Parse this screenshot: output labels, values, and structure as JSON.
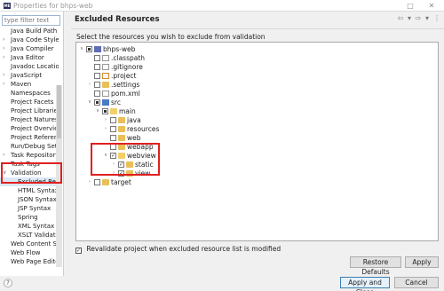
{
  "window": {
    "app_icon": "ME",
    "title": "Properties for bhps-web",
    "controls": [
      "□",
      "✕"
    ]
  },
  "left": {
    "filter_placeholder": "type filter text",
    "items": [
      {
        "label": "Java Build Path"
      },
      {
        "label": "Java Code Style",
        "caret": "›"
      },
      {
        "label": "Java Compiler",
        "caret": "›"
      },
      {
        "label": "Java Editor",
        "caret": "›"
      },
      {
        "label": "Javadoc Location"
      },
      {
        "label": "JavaScript",
        "caret": "›"
      },
      {
        "label": "Maven",
        "caret": "›"
      },
      {
        "label": "Namespaces"
      },
      {
        "label": "Project Facets"
      },
      {
        "label": "Project Libraries"
      },
      {
        "label": "Project Natures"
      },
      {
        "label": "Project Overview"
      },
      {
        "label": "Project References"
      },
      {
        "label": "Run/Debug Settings"
      },
      {
        "label": "Task Repository",
        "caret": "›"
      },
      {
        "label": "Task Tags"
      },
      {
        "label": "Validation",
        "caret": "∨"
      },
      {
        "label": "Excluded Resources",
        "child": true,
        "selected": true
      },
      {
        "label": "HTML Syntax",
        "child": true
      },
      {
        "label": "JSON Syntax",
        "child": true
      },
      {
        "label": "JSP Syntax",
        "child": true
      },
      {
        "label": "Spring",
        "child": true
      },
      {
        "label": "XML Syntax",
        "child": true
      },
      {
        "label": "XSLT Validation",
        "child": true
      },
      {
        "label": "Web Content Settings"
      },
      {
        "label": "Web Flow"
      },
      {
        "label": "Web Page Editor"
      }
    ]
  },
  "main": {
    "title": "Excluded Resources",
    "toolbar": [
      "⇦",
      "▾",
      "⇨",
      "▾",
      "⋮"
    ],
    "description": "Select the resources you wish to exclude from validation",
    "tree": [
      {
        "label": "bhps-web",
        "depth": 0,
        "twisty": "∨",
        "check": "partial",
        "icon": "project"
      },
      {
        "label": ".classpath",
        "depth": 1,
        "twisty": "",
        "check": "none",
        "icon": "file"
      },
      {
        "label": ".gitignore",
        "depth": 1,
        "twisty": "",
        "check": "none",
        "icon": "file"
      },
      {
        "label": ".project",
        "depth": 1,
        "twisty": "",
        "check": "none",
        "icon": "file-x"
      },
      {
        "label": ".settings",
        "depth": 1,
        "twisty": "›",
        "check": "none",
        "icon": "folder"
      },
      {
        "label": "pom.xml",
        "depth": 1,
        "twisty": "",
        "check": "none",
        "icon": "file"
      },
      {
        "label": "src",
        "depth": 1,
        "twisty": "∨",
        "check": "partial",
        "icon": "src"
      },
      {
        "label": "main",
        "depth": 2,
        "twisty": "∨",
        "check": "partial",
        "icon": "folder-open"
      },
      {
        "label": "java",
        "depth": 3,
        "twisty": "›",
        "check": "none",
        "icon": "folder"
      },
      {
        "label": "resources",
        "depth": 3,
        "twisty": "›",
        "check": "none",
        "icon": "folder"
      },
      {
        "label": "web",
        "depth": 3,
        "twisty": "",
        "check": "none",
        "icon": "folder"
      },
      {
        "label": "webapp",
        "depth": 3,
        "twisty": "",
        "check": "none",
        "icon": "folder"
      },
      {
        "label": "webview",
        "depth": 3,
        "twisty": "∨",
        "check": "checked",
        "icon": "folder-open"
      },
      {
        "label": "static",
        "depth": 4,
        "twisty": "›",
        "check": "checked",
        "icon": "folder"
      },
      {
        "label": "view",
        "depth": 4,
        "twisty": "›",
        "check": "checked",
        "icon": "folder"
      },
      {
        "label": "target",
        "depth": 1,
        "twisty": "›",
        "check": "none",
        "icon": "folder"
      }
    ],
    "revalidate_label": "Revalidate project when excluded resource list is modified",
    "revalidate_checked": "✓",
    "restore_defaults_label": "Restore Defaults",
    "apply_label": "Apply"
  },
  "footer": {
    "help_label": "?",
    "apply_close_label": "Apply and Close",
    "cancel_label": "Cancel"
  },
  "colors": {
    "highlight_box": "#e02020",
    "selection": "#dbe8f6",
    "primary_border": "#3c7fb1"
  }
}
